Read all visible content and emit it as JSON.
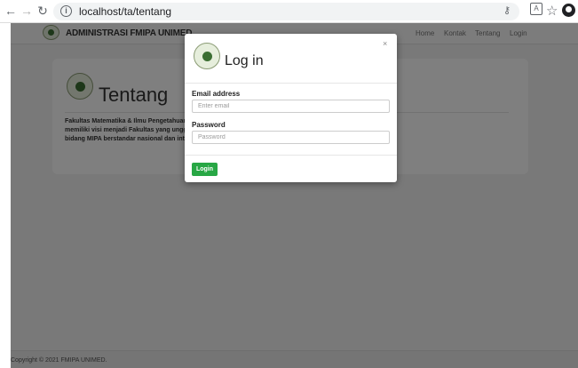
{
  "browser": {
    "url": "localhost/ta/tentang"
  },
  "navbar": {
    "brand": "ADMINISTRASI FMIPA UNIMED",
    "links": [
      "Home",
      "Kontak",
      "Tentang",
      "Login"
    ]
  },
  "card": {
    "title": "Tentang",
    "text_lines": [
      "Fakultas Matematika & Ilmu Pengetahuan Un",
      "memiliki visi menjadi Fakultas yang unggul d",
      "bidang MIPA berstandar nasional dan interna"
    ]
  },
  "footer": {
    "text": "Copyright © 2021 FMIPA UNIMED."
  },
  "modal": {
    "title": "Log in",
    "close": "×",
    "email_label": "Email address",
    "email_placeholder": "Enter email",
    "password_label": "Password",
    "password_placeholder": "Password",
    "submit_label": "Login"
  },
  "colors": {
    "accent_green": "#28a745"
  }
}
